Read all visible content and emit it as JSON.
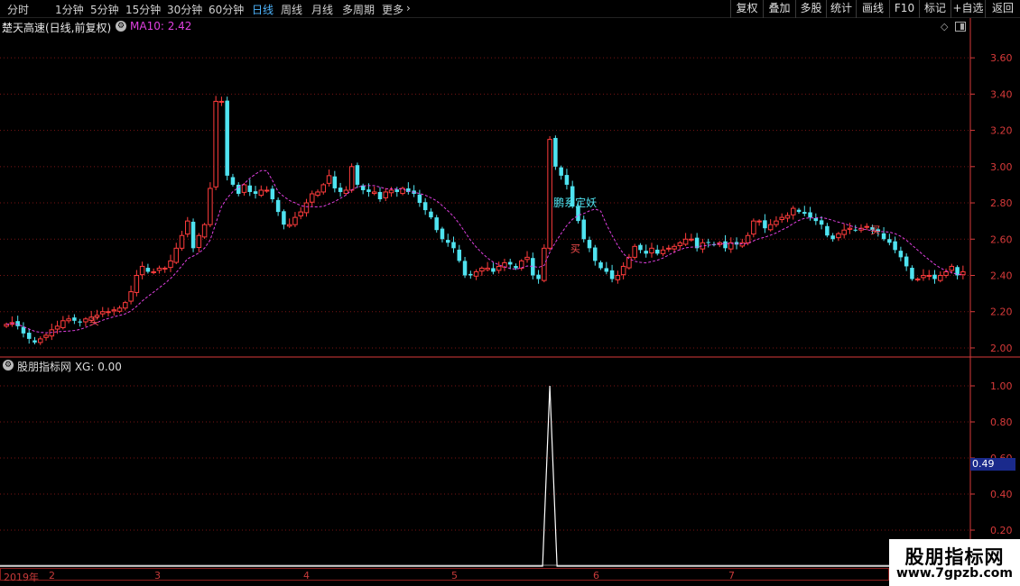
{
  "toolbar": {
    "periods": [
      "分时",
      "1分钟",
      "5分钟",
      "15分钟",
      "30分钟",
      "60分钟",
      "日线",
      "周线",
      "月线",
      "多周期",
      "更多"
    ],
    "active_period": "日线",
    "more_arrow": "›",
    "right_buttons": [
      "复权",
      "叠加",
      "多股",
      "统计",
      "画线",
      "F10",
      "标记",
      "+自选",
      "返回"
    ]
  },
  "info": {
    "stock_title": "楚天高速(日线,前复权)",
    "ma_label": "MA10: 2.42",
    "ma_color": "#e040e0",
    "badge_icon": "gear-icon",
    "diamond_icon": "diamond-icon",
    "panel_icon": "panel-toggle-icon"
  },
  "indicator": {
    "label": "股朋指标网 XG: 0.00",
    "current_value": "0.49"
  },
  "dates": {
    "year": "2019年",
    "months": [
      "2",
      "3",
      "4",
      "5",
      "6",
      "7"
    ]
  },
  "annotations": {
    "signal_text": "鹏系定妖",
    "buy_text": "买"
  },
  "watermark": {
    "line1": "股朋指标网",
    "line2": "www.7gpzb.com"
  },
  "colors": {
    "up": "#ff3c3c",
    "down": "#4fe3f0",
    "ma": "#e040e0",
    "grid": "#7a1515",
    "axis": "#d83a3a",
    "indicator": "#ffffff"
  },
  "chart_data": [
    {
      "type": "candlestick",
      "title": "楚天高速(日线,前复权)",
      "y_ticks": [
        "2.00",
        "2.20",
        "2.40",
        "2.60",
        "2.80",
        "3.00",
        "3.20",
        "3.40",
        "3.60"
      ],
      "ylim": [
        1.95,
        3.72
      ],
      "closes": [
        2.13,
        2.14,
        2.12,
        2.08,
        2.05,
        2.03,
        2.05,
        2.07,
        2.1,
        2.12,
        2.15,
        2.16,
        2.15,
        2.14,
        2.16,
        2.17,
        2.18,
        2.2,
        2.2,
        2.21,
        2.22,
        2.25,
        2.31,
        2.4,
        2.45,
        2.42,
        2.42,
        2.44,
        2.44,
        2.48,
        2.55,
        2.62,
        2.7,
        2.55,
        2.62,
        2.68,
        2.88,
        3.36,
        3.36,
        2.95,
        2.9,
        2.85,
        2.9,
        2.86,
        2.85,
        2.87,
        2.87,
        2.82,
        2.75,
        2.68,
        2.68,
        2.72,
        2.75,
        2.8,
        2.85,
        2.86,
        2.9,
        2.95,
        2.88,
        2.86,
        2.87,
        3.0,
        2.9,
        2.87,
        2.86,
        2.86,
        2.82,
        2.86,
        2.87,
        2.86,
        2.88,
        2.86,
        2.85,
        2.8,
        2.76,
        2.72,
        2.65,
        2.6,
        2.58,
        2.55,
        2.48,
        2.4,
        2.4,
        2.42,
        2.44,
        2.44,
        2.42,
        2.45,
        2.47,
        2.46,
        2.44,
        2.48,
        2.5,
        2.4,
        2.38,
        2.55,
        3.15,
        3.0,
        2.95,
        2.9,
        2.78,
        2.7,
        2.6,
        2.55,
        2.48,
        2.44,
        2.42,
        2.38,
        2.4,
        2.45,
        2.5,
        2.56,
        2.54,
        2.52,
        2.55,
        2.52,
        2.54,
        2.55,
        2.56,
        2.58,
        2.6,
        2.6,
        2.55,
        2.58,
        2.58,
        2.57,
        2.58,
        2.55,
        2.58,
        2.57,
        2.58,
        2.62,
        2.7,
        2.7,
        2.66,
        2.68,
        2.7,
        2.72,
        2.73,
        2.77,
        2.75,
        2.74,
        2.72,
        2.7,
        2.68,
        2.62,
        2.6,
        2.63,
        2.65,
        2.66,
        2.65,
        2.66,
        2.67,
        2.65,
        2.64,
        2.6,
        2.58,
        2.54,
        2.5,
        2.45,
        2.38,
        2.38,
        2.4,
        2.4,
        2.38,
        2.4,
        2.42,
        2.45,
        2.4,
        2.42
      ],
      "ma_series_name": "MA10",
      "signal_label": "鹏系定妖",
      "buy_labels": [
        "买",
        "买",
        "买"
      ]
    },
    {
      "type": "line",
      "series": [
        {
          "name": "XG",
          "spike_index": 96,
          "spike_value": 1.0
        }
      ],
      "y_ticks": [
        "0.20",
        "0.40",
        "0.60",
        "0.80",
        "1.00"
      ],
      "ylim": [
        0.0,
        1.08
      ],
      "current_value": "0.49"
    }
  ]
}
